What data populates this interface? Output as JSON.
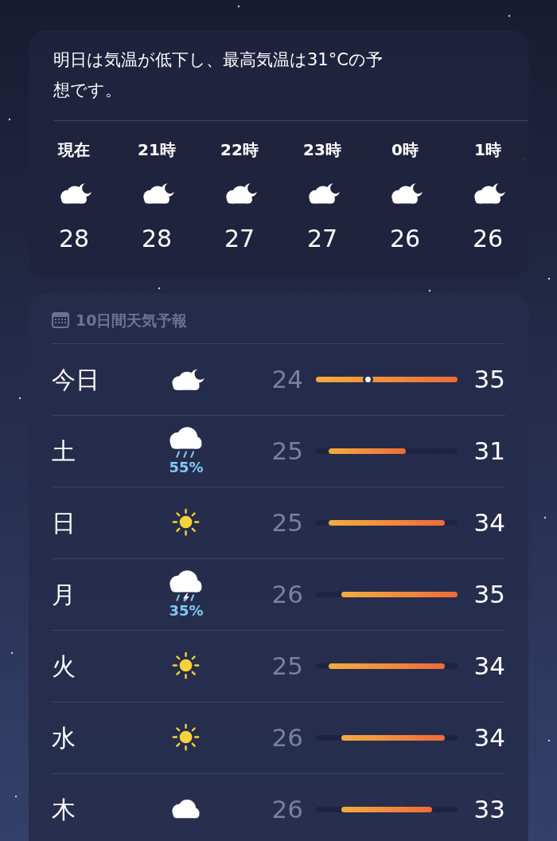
{
  "summary": {
    "text": "明日は気温が低下し、最高気温は31°Cの予想です。"
  },
  "hourly": [
    {
      "label": "現在",
      "kind": "cloud-moon",
      "temp": "28"
    },
    {
      "label": "21時",
      "kind": "cloud-moon",
      "temp": "28"
    },
    {
      "label": "22時",
      "kind": "cloud-moon",
      "temp": "27"
    },
    {
      "label": "23時",
      "kind": "cloud-moon",
      "temp": "27"
    },
    {
      "label": "0時",
      "kind": "cloud-moon",
      "temp": "26"
    },
    {
      "label": "1時",
      "kind": "cloud-moon",
      "temp": "26"
    }
  ],
  "daily": {
    "title": "10日間天気予報",
    "days": [
      {
        "day": "今日",
        "kind": "cloud-moon",
        "low": "24",
        "high": "35",
        "now": true
      },
      {
        "day": "土",
        "kind": "cloud-rain",
        "precip": "55%",
        "low": "25",
        "high": "31",
        "now": false
      },
      {
        "day": "日",
        "kind": "sun",
        "low": "25",
        "high": "34",
        "now": false
      },
      {
        "day": "月",
        "kind": "cloud-bolt",
        "precip": "35%",
        "low": "26",
        "high": "35",
        "now": false
      },
      {
        "day": "火",
        "kind": "sun",
        "low": "25",
        "high": "34",
        "now": false
      },
      {
        "day": "水",
        "kind": "sun",
        "low": "26",
        "high": "34",
        "now": false
      },
      {
        "day": "木",
        "kind": "cloud",
        "low": "26",
        "high": "33",
        "now": false
      }
    ]
  }
}
